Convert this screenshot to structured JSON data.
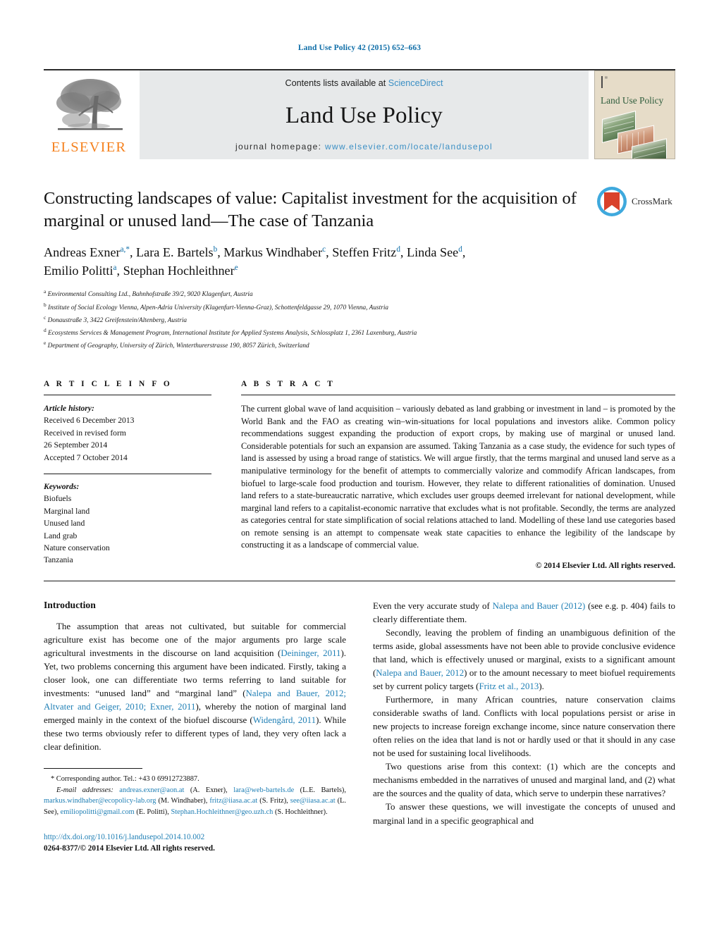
{
  "running_head": "Land Use Policy 42 (2015) 652–663",
  "masthead": {
    "contents_prefix": "Contents lists available at ",
    "sciencedirect": "ScienceDirect",
    "journal_title": "Land Use Policy",
    "homepage_label": "journal homepage: ",
    "homepage_url": "www.elsevier.com/locate/landusepol",
    "publisher_logo_text": "ELSEVIER",
    "cover_title": "Land Use Policy",
    "accent_link_color": "#3b8fc4",
    "elsevier_orange": "#f58220"
  },
  "article": {
    "title": "Constructing landscapes of value: Capitalist investment for the acquisition of marginal or unused land—The case of Tanzania",
    "authors_line_1": "Andreas Exner",
    "authors": [
      {
        "name": "Andreas Exner",
        "marks": "a,*"
      },
      {
        "name": "Lara E. Bartels",
        "marks": "b"
      },
      {
        "name": "Markus Windhaber",
        "marks": "c"
      },
      {
        "name": "Steffen Fritz",
        "marks": "d"
      },
      {
        "name": "Linda See",
        "marks": "d"
      },
      {
        "name": "Emilio Politti",
        "marks": "a"
      },
      {
        "name": "Stephan Hochleithner",
        "marks": "e"
      }
    ],
    "affiliations": [
      {
        "mark": "a",
        "text": "Environmental Consulting Ltd., Bahnhofstraße 39/2, 9020 Klagenfurt, Austria"
      },
      {
        "mark": "b",
        "text": "Institute of Social Ecology Vienna, Alpen-Adria University (Klagenfurt-Vienna-Graz), Schottenfeldgasse 29, 1070 Vienna, Austria"
      },
      {
        "mark": "c",
        "text": "Donaustraße 3, 3422 Greifenstein/Altenberg, Austria"
      },
      {
        "mark": "d",
        "text": "Ecosystems Services & Management Program, International Institute for Applied Systems Analysis, Schlossplatz 1, 2361 Laxenburg, Austria"
      },
      {
        "mark": "e",
        "text": "Department of Geography, University of Zürich, Winterthurerstrasse 190, 8057 Zürich, Switzerland"
      }
    ],
    "crossmark_label": "CrossMark"
  },
  "article_info": {
    "heading": "A R T I C L E   I N F O",
    "history_label": "Article history:",
    "history": [
      "Received 6 December 2013",
      "Received in revised form",
      "26 September 2014",
      "Accepted 7 October 2014"
    ],
    "keywords_label": "Keywords:",
    "keywords": [
      "Biofuels",
      "Marginal land",
      "Unused land",
      "Land grab",
      "Nature conservation",
      "Tanzania"
    ]
  },
  "abstract": {
    "heading": "A B S T R A C T",
    "text": "The current global wave of land acquisition – variously debated as land grabbing or investment in land – is promoted by the World Bank and the FAO as creating win–win-situations for local populations and investors alike. Common policy recommendations suggest expanding the production of export crops, by making use of marginal or unused land. Considerable potentials for such an expansion are assumed. Taking Tanzania as a case study, the evidence for such types of land is assessed by using a broad range of statistics. We will argue firstly, that the terms marginal and unused land serve as a manipulative terminology for the benefit of attempts to commercially valorize and commodify African landscapes, from biofuel to large-scale food production and tourism. However, they relate to different rationalities of domination. Unused land refers to a state-bureaucratic narrative, which excludes user groups deemed irrelevant for national development, while marginal land refers to a capitalist-economic narrative that excludes what is not profitable. Secondly, the terms are analyzed as categories central for state simplification of social relations attached to land. Modelling of these land use categories based on remote sensing is an attempt to compensate weak state capacities to enhance the legibility of the landscape by constructing it as a landscape of commercial value.",
    "copyright": "© 2014 Elsevier Ltd. All rights reserved."
  },
  "body": {
    "intro_heading": "Introduction",
    "left_paragraphs": [
      "The assumption that areas not cultivated, but suitable for commercial agriculture exist has become one of the major arguments pro large scale agricultural investments in the discourse on land acquisition (Deininger, 2011). Yet, two problems concerning this argument have been indicated. Firstly, taking a closer look, one can differentiate two terms referring to land suitable for investments: “unused land” and “marginal land” (Nalepa and Bauer, 2012; Altvater and Geiger, 2010; Exner, 2011), whereby the notion of marginal land emerged mainly in the context of the biofuel discourse (Widengård, 2011). While these two terms obviously refer to different types of land, they very often lack a clear definition."
    ],
    "right_paragraphs": [
      "Even the very accurate study of Nalepa and Bauer (2012) (see e.g. p. 404) fails to clearly differentiate them.",
      "Secondly, leaving the problem of finding an unambiguous definition of the terms aside, global assessments have not been able to provide conclusive evidence that land, which is effectively unused or marginal, exists to a significant amount (Nalepa and Bauer, 2012) or to the amount necessary to meet biofuel requirements set by current policy targets (Fritz et al., 2013).",
      "Furthermore, in many African countries, nature conservation claims considerable swaths of land. Conflicts with local populations persist or arise in new projects to increase foreign exchange income, since nature conservation there often relies on the idea that land is not or hardly used or that it should in any case not be used for sustaining local livelihoods.",
      "Two questions arise from this context: (1) which are the concepts and mechanisms embedded in the narratives of unused and marginal land, and (2) what are the sources and the quality of data, which serve to underpin these narratives?",
      "To answer these questions, we will investigate the concepts of unused and marginal land in a specific geographical and"
    ]
  },
  "footnote": {
    "corresponding": "* Corresponding author. Tel.: +43 0 69912723887.",
    "email_label": "E-mail addresses:",
    "emails": [
      {
        "address": "andreas.exner@aon.at",
        "owner": "(A. Exner)"
      },
      {
        "address": "lara@web-bartels.de",
        "owner": "(L.E. Bartels)"
      },
      {
        "address": "markus.windhaber@ecopolicy-lab.org",
        "owner": "(M. Windhaber)"
      },
      {
        "address": "fritz@iiasa.ac.at",
        "owner": "(S. Fritz)"
      },
      {
        "address": "see@iiasa.ac.at",
        "owner": "(L. See)"
      },
      {
        "address": "emiliopolitti@gmail.com",
        "owner": "(E. Politti)"
      },
      {
        "address": "Stephan.Hochleithner@geo.uzh.ch",
        "owner": "(S. Hochleithner)"
      }
    ],
    "doi": "http://dx.doi.org/10.1016/j.landusepol.2014.10.002",
    "issn_line": "0264-8377/© 2014 Elsevier Ltd. All rights reserved."
  }
}
